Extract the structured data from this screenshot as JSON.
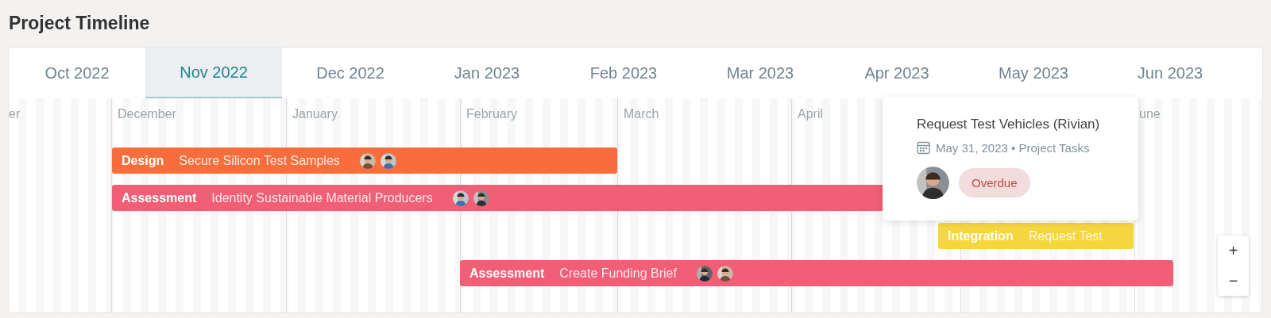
{
  "title": "Project Timeline",
  "tabs": [
    {
      "label": "Oct 2022",
      "selected": false
    },
    {
      "label": "Nov 2022",
      "selected": true
    },
    {
      "label": "Dec 2022",
      "selected": false
    },
    {
      "label": "Jan 2023",
      "selected": false
    },
    {
      "label": "Feb 2023",
      "selected": false
    },
    {
      "label": "Mar 2023",
      "selected": false
    },
    {
      "label": "Apr 2023",
      "selected": false
    },
    {
      "label": "May 2023",
      "selected": false
    },
    {
      "label": "Jun 2023",
      "selected": false
    }
  ],
  "months": [
    "er",
    "December",
    "January",
    "February",
    "March",
    "April",
    "une"
  ],
  "bars": [
    {
      "category": "Design",
      "task": "Secure Silicon Test Samples",
      "color": "#f76e3c"
    },
    {
      "category": "Assessment",
      "task": "Identity Sustainable Material Producers",
      "color": "#f05f75"
    },
    {
      "category": "Integration",
      "task": "Request Test",
      "color": "#f5d63f"
    },
    {
      "category": "Assessment",
      "task": "Create Funding Brief",
      "color": "#f05f75"
    }
  ],
  "tooltip": {
    "title": "Request Test Vehicles (Rivian)",
    "meta": "May 31, 2023 • Project Tasks",
    "status": "Overdue"
  },
  "zoom_controls": [
    "+",
    "−"
  ]
}
